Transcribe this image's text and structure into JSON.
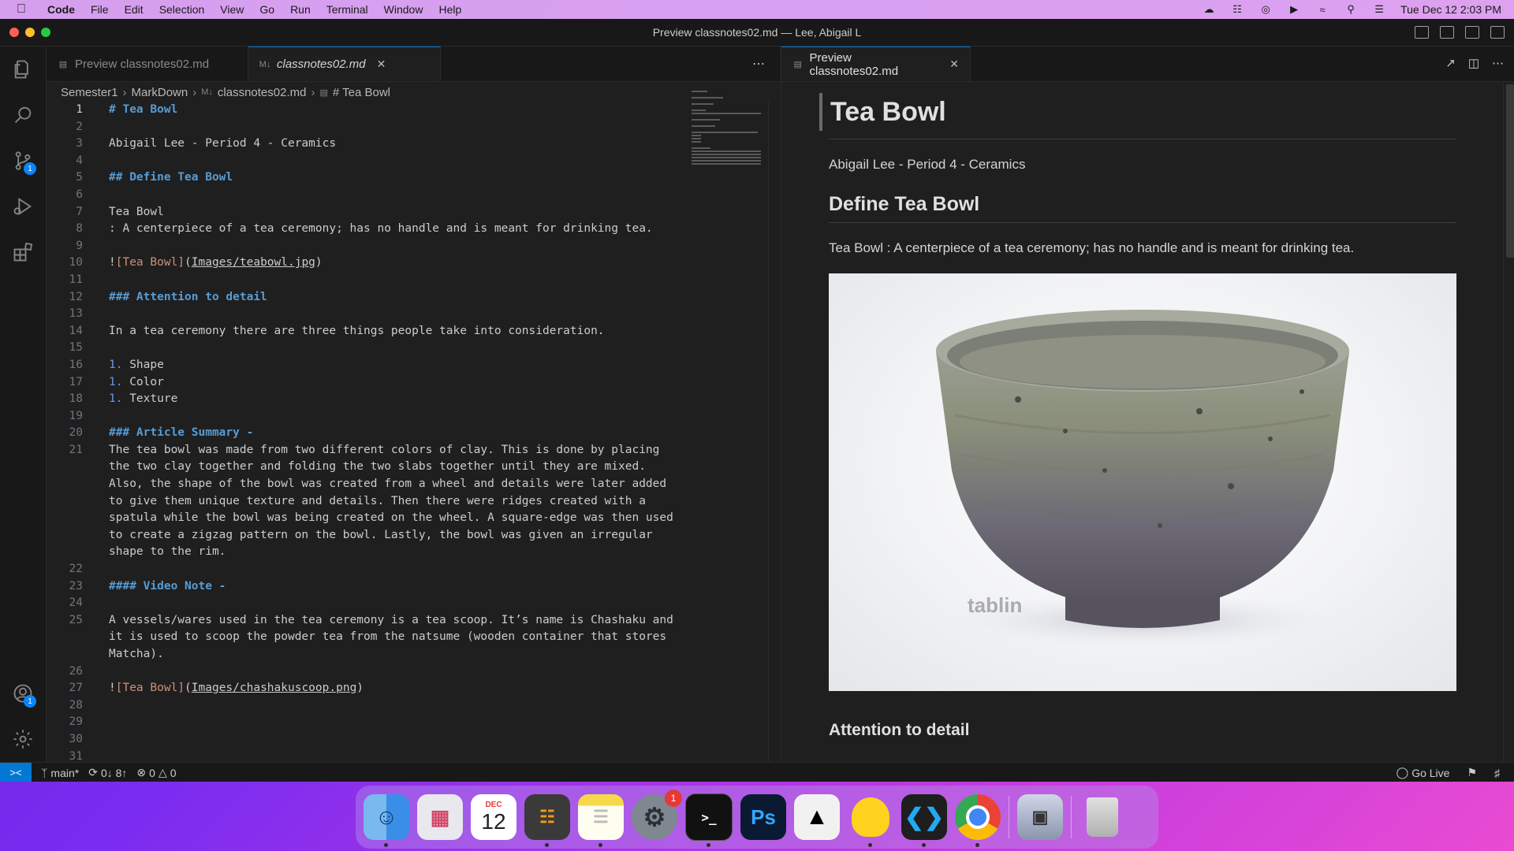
{
  "menubar": {
    "app": "Code",
    "items": [
      "File",
      "Edit",
      "Selection",
      "View",
      "Go",
      "Run",
      "Terminal",
      "Window",
      "Help"
    ],
    "clock": "Tue Dec 12  2:03 PM"
  },
  "window": {
    "title": "Preview classnotes02.md — Lee, Abigail L"
  },
  "activity": {
    "source_control_badge": "1",
    "accounts_badge": "1"
  },
  "left_tabs": [
    {
      "label": "Preview classnotes02.md"
    },
    {
      "label": "classnotes02.md"
    }
  ],
  "breadcrumb": [
    "Semester1",
    "MarkDown",
    "classnotes02.md",
    "# Tea Bowl"
  ],
  "editor": {
    "lines": [
      {
        "n": "1",
        "text": "# Tea Bowl"
      },
      {
        "n": "2",
        "text": ""
      },
      {
        "n": "3",
        "text": "Abigail Lee - Period 4 - Ceramics"
      },
      {
        "n": "4",
        "text": ""
      },
      {
        "n": "5",
        "text": "## Define Tea Bowl"
      },
      {
        "n": "6",
        "text": ""
      },
      {
        "n": "7",
        "text": "Tea Bowl"
      },
      {
        "n": "8",
        "text": ": A centerpiece of a tea ceremony; has no handle and is meant for drinking tea."
      },
      {
        "n": "9",
        "text": ""
      },
      {
        "n": "10",
        "text": "![Tea Bowl](Images/teabowl.jpg)"
      },
      {
        "n": "11",
        "text": ""
      },
      {
        "n": "12",
        "text": "### Attention to detail"
      },
      {
        "n": "13",
        "text": ""
      },
      {
        "n": "14",
        "text": "In a tea ceremony there are three things people take into consideration."
      },
      {
        "n": "15",
        "text": ""
      },
      {
        "n": "16",
        "text": "1. Shape"
      },
      {
        "n": "17",
        "text": "1. Color"
      },
      {
        "n": "18",
        "text": "1. Texture"
      },
      {
        "n": "19",
        "text": ""
      },
      {
        "n": "20",
        "text": "### Article Summary -"
      },
      {
        "n": "21",
        "text": "The tea bowl was made from two different colors of clay. This is done by placing"
      },
      {
        "n": "",
        "text": "the two clay together and folding the two slabs together until they are mixed."
      },
      {
        "n": "",
        "text": "Also, the shape of the bowl was created from a wheel and details were later added"
      },
      {
        "n": "",
        "text": "to give them unique texture and details. Then there were ridges created with a"
      },
      {
        "n": "",
        "text": "spatula while the bowl was being created on the wheel. A square-edge was then used"
      },
      {
        "n": "",
        "text": "to create a zigzag pattern on the bowl. Lastly, the bowl was given an irregular"
      },
      {
        "n": "",
        "text": "shape to the rim."
      },
      {
        "n": "22",
        "text": ""
      },
      {
        "n": "23",
        "text": "#### Video Note -"
      },
      {
        "n": "24",
        "text": ""
      },
      {
        "n": "25",
        "text": "A vessels/wares used in the tea ceremony is a tea scoop. It’s name is Chashaku and"
      },
      {
        "n": "",
        "text": "it is used to scoop the powder tea from the natsume (wooden container that stores"
      },
      {
        "n": "",
        "text": "Matcha)."
      },
      {
        "n": "26",
        "text": ""
      },
      {
        "n": "27",
        "text": "![Tea Bowl](Images/chashakuscoop.png)"
      },
      {
        "n": "28",
        "text": ""
      },
      {
        "n": "29",
        "text": ""
      },
      {
        "n": "30",
        "text": ""
      },
      {
        "n": "31",
        "text": ""
      }
    ]
  },
  "preview": {
    "tab": "Preview classnotes02.md",
    "h1": "Tea Bowl",
    "byline": "Abigail Lee - Period 4 - Ceramics",
    "h2": "Define Tea Bowl",
    "definition": "Tea Bowl : A centerpiece of a tea ceremony; has no handle and is meant for drinking tea.",
    "image_watermark": "tablin",
    "h3": "Attention to detail"
  },
  "status": {
    "branch": "main*",
    "sync": "0↓ 8↑",
    "errors": "0",
    "warnings": "0",
    "go_live": "Go Live"
  },
  "dock": {
    "calendar_month": "DEC",
    "calendar_day": "12",
    "settings_badge": "1",
    "photoshop_label": "Ps",
    "terminal_label": ">_"
  }
}
